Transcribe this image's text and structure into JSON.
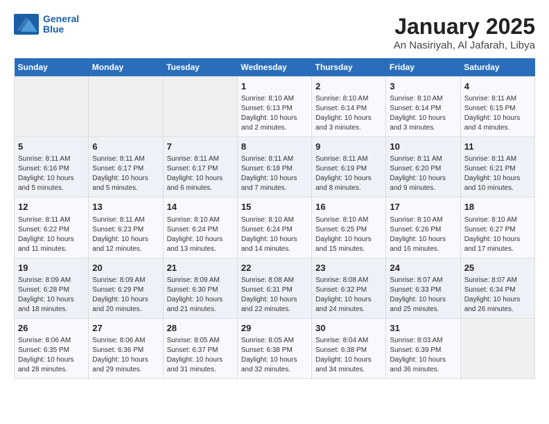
{
  "logo": {
    "line1": "General",
    "line2": "Blue"
  },
  "title": "January 2025",
  "subtitle": "An Nasiriyah, Al Jafarah, Libya",
  "days_of_week": [
    "Sunday",
    "Monday",
    "Tuesday",
    "Wednesday",
    "Thursday",
    "Friday",
    "Saturday"
  ],
  "weeks": [
    [
      {
        "day": "",
        "info": ""
      },
      {
        "day": "",
        "info": ""
      },
      {
        "day": "",
        "info": ""
      },
      {
        "day": "1",
        "info": "Sunrise: 8:10 AM\nSunset: 6:13 PM\nDaylight: 10 hours\nand 2 minutes."
      },
      {
        "day": "2",
        "info": "Sunrise: 8:10 AM\nSunset: 6:14 PM\nDaylight: 10 hours\nand 3 minutes."
      },
      {
        "day": "3",
        "info": "Sunrise: 8:10 AM\nSunset: 6:14 PM\nDaylight: 10 hours\nand 3 minutes."
      },
      {
        "day": "4",
        "info": "Sunrise: 8:11 AM\nSunset: 6:15 PM\nDaylight: 10 hours\nand 4 minutes."
      }
    ],
    [
      {
        "day": "5",
        "info": "Sunrise: 8:11 AM\nSunset: 6:16 PM\nDaylight: 10 hours\nand 5 minutes."
      },
      {
        "day": "6",
        "info": "Sunrise: 8:11 AM\nSunset: 6:17 PM\nDaylight: 10 hours\nand 5 minutes."
      },
      {
        "day": "7",
        "info": "Sunrise: 8:11 AM\nSunset: 6:17 PM\nDaylight: 10 hours\nand 6 minutes."
      },
      {
        "day": "8",
        "info": "Sunrise: 8:11 AM\nSunset: 6:18 PM\nDaylight: 10 hours\nand 7 minutes."
      },
      {
        "day": "9",
        "info": "Sunrise: 8:11 AM\nSunset: 6:19 PM\nDaylight: 10 hours\nand 8 minutes."
      },
      {
        "day": "10",
        "info": "Sunrise: 8:11 AM\nSunset: 6:20 PM\nDaylight: 10 hours\nand 9 minutes."
      },
      {
        "day": "11",
        "info": "Sunrise: 8:11 AM\nSunset: 6:21 PM\nDaylight: 10 hours\nand 10 minutes."
      }
    ],
    [
      {
        "day": "12",
        "info": "Sunrise: 8:11 AM\nSunset: 6:22 PM\nDaylight: 10 hours\nand 11 minutes."
      },
      {
        "day": "13",
        "info": "Sunrise: 8:11 AM\nSunset: 6:23 PM\nDaylight: 10 hours\nand 12 minutes."
      },
      {
        "day": "14",
        "info": "Sunrise: 8:10 AM\nSunset: 6:24 PM\nDaylight: 10 hours\nand 13 minutes."
      },
      {
        "day": "15",
        "info": "Sunrise: 8:10 AM\nSunset: 6:24 PM\nDaylight: 10 hours\nand 14 minutes."
      },
      {
        "day": "16",
        "info": "Sunrise: 8:10 AM\nSunset: 6:25 PM\nDaylight: 10 hours\nand 15 minutes."
      },
      {
        "day": "17",
        "info": "Sunrise: 8:10 AM\nSunset: 6:26 PM\nDaylight: 10 hours\nand 16 minutes."
      },
      {
        "day": "18",
        "info": "Sunrise: 8:10 AM\nSunset: 6:27 PM\nDaylight: 10 hours\nand 17 minutes."
      }
    ],
    [
      {
        "day": "19",
        "info": "Sunrise: 8:09 AM\nSunset: 6:28 PM\nDaylight: 10 hours\nand 18 minutes."
      },
      {
        "day": "20",
        "info": "Sunrise: 8:09 AM\nSunset: 6:29 PM\nDaylight: 10 hours\nand 20 minutes."
      },
      {
        "day": "21",
        "info": "Sunrise: 8:09 AM\nSunset: 6:30 PM\nDaylight: 10 hours\nand 21 minutes."
      },
      {
        "day": "22",
        "info": "Sunrise: 8:08 AM\nSunset: 6:31 PM\nDaylight: 10 hours\nand 22 minutes."
      },
      {
        "day": "23",
        "info": "Sunrise: 8:08 AM\nSunset: 6:32 PM\nDaylight: 10 hours\nand 24 minutes."
      },
      {
        "day": "24",
        "info": "Sunrise: 8:07 AM\nSunset: 6:33 PM\nDaylight: 10 hours\nand 25 minutes."
      },
      {
        "day": "25",
        "info": "Sunrise: 8:07 AM\nSunset: 6:34 PM\nDaylight: 10 hours\nand 26 minutes."
      }
    ],
    [
      {
        "day": "26",
        "info": "Sunrise: 8:06 AM\nSunset: 6:35 PM\nDaylight: 10 hours\nand 28 minutes."
      },
      {
        "day": "27",
        "info": "Sunrise: 8:06 AM\nSunset: 6:36 PM\nDaylight: 10 hours\nand 29 minutes."
      },
      {
        "day": "28",
        "info": "Sunrise: 8:05 AM\nSunset: 6:37 PM\nDaylight: 10 hours\nand 31 minutes."
      },
      {
        "day": "29",
        "info": "Sunrise: 8:05 AM\nSunset: 6:38 PM\nDaylight: 10 hours\nand 32 minutes."
      },
      {
        "day": "30",
        "info": "Sunrise: 8:04 AM\nSunset: 6:38 PM\nDaylight: 10 hours\nand 34 minutes."
      },
      {
        "day": "31",
        "info": "Sunrise: 8:03 AM\nSunset: 6:39 PM\nDaylight: 10 hours\nand 36 minutes."
      },
      {
        "day": "",
        "info": ""
      }
    ]
  ]
}
